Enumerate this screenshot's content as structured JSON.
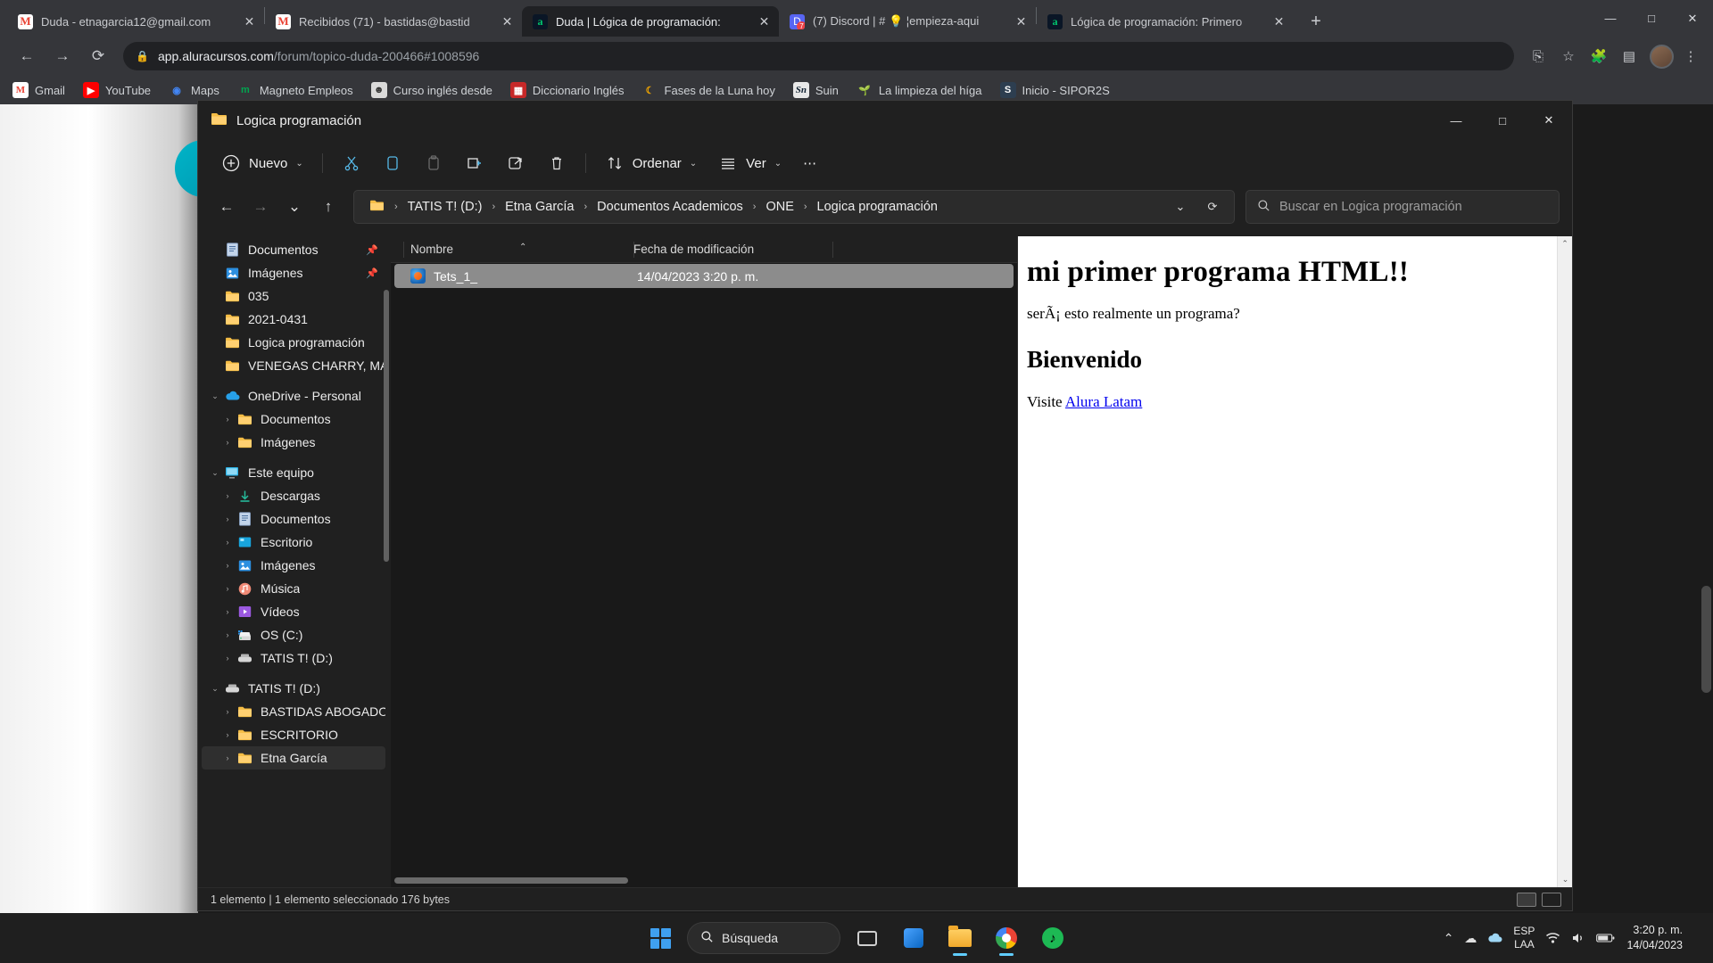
{
  "browser": {
    "tabs": [
      {
        "title": "Duda - etnagarcia12@gmail.com",
        "favicon": "gmail-icon",
        "active": false
      },
      {
        "title": "Recibidos (71) - bastidas@bastid",
        "favicon": "gmail-icon",
        "active": false
      },
      {
        "title": "Duda | Lógica de programación: ",
        "favicon": "alura-icon",
        "active": true
      },
      {
        "title": "(7) Discord | # 💡 ¦empieza-aqui ",
        "favicon": "discord-icon",
        "active": false
      },
      {
        "title": "Lógica de programación: Primero",
        "favicon": "alura-icon",
        "active": false
      }
    ],
    "new_tab_label": "+",
    "window_controls": {
      "minimize": "—",
      "maximize": "□",
      "close": "✕"
    },
    "nav": {
      "back": "←",
      "forward": "→",
      "reload": "⟳"
    },
    "url": {
      "lock": "🔒",
      "host": "app.aluracursos.com",
      "path": "/forum/topico-duda-200466#1008596"
    },
    "omnibox_end": {
      "install": "⎘",
      "bookmark": "☆",
      "extensions": "🧩",
      "sidepanel": "▤",
      "menu": "⋮"
    },
    "bookmarks": [
      {
        "label": "Gmail",
        "icon": "gmail-icon"
      },
      {
        "label": "YouTube",
        "icon": "youtube-icon"
      },
      {
        "label": "Maps",
        "icon": "maps-pin-icon"
      },
      {
        "label": "Magneto Empleos",
        "icon": "magneto-icon"
      },
      {
        "label": "Curso inglés desde",
        "icon": "photo-icon"
      },
      {
        "label": "Diccionario Inglés",
        "icon": "dictionary-icon"
      },
      {
        "label": "Fases de la Luna hoy",
        "icon": "moon-icon"
      },
      {
        "label": "Suin",
        "icon": "suin-icon"
      },
      {
        "label": "La limpieza del híga",
        "icon": "plant-icon"
      },
      {
        "label": "Inicio - SIPOR2S",
        "icon": "sipor-icon"
      }
    ]
  },
  "explorer": {
    "title": "Logica programación",
    "title_icon": "folder-icon",
    "window_controls": {
      "minimize": "—",
      "maximize": "□",
      "close": "✕"
    },
    "toolbar": {
      "new_label": "Nuevo",
      "new_icon": "plus-circle-icon",
      "cut_icon": "scissors-icon",
      "copy_icon": "copy-icon",
      "paste_icon": "paste-icon",
      "rename_icon": "rename-icon",
      "share_icon": "share-icon",
      "delete_icon": "trash-icon",
      "sort_label": "Ordenar",
      "sort_icon": "sort-arrows-icon",
      "view_label": "Ver",
      "view_icon": "list-view-icon",
      "more_label": "⋯",
      "caret": "⌄"
    },
    "address": {
      "back": "←",
      "forward": "→",
      "recent": "⌄",
      "up": "↑",
      "folder_icon": "folder-icon",
      "breadcrumb": [
        "TATIS T! (D:)",
        "Etna García",
        "Documentos Academicos",
        "ONE",
        "Logica programación"
      ],
      "separator": "›",
      "dropdown": "⌄",
      "refresh": "⟳",
      "search_placeholder": "Buscar en Logica programación",
      "search_value": "",
      "search_icon": "search-icon"
    },
    "nav_pane": [
      {
        "label": "Documentos",
        "icon": "documents-icon",
        "chevron": "",
        "pinned": true,
        "indent": 1,
        "selected": false
      },
      {
        "label": "Imágenes",
        "icon": "pictures-icon",
        "chevron": "",
        "pinned": true,
        "indent": 1,
        "selected": false
      },
      {
        "label": "035",
        "icon": "folder-icon",
        "chevron": "",
        "pinned": false,
        "indent": 1,
        "selected": false
      },
      {
        "label": "2021-0431",
        "icon": "folder-icon",
        "chevron": "",
        "pinned": false,
        "indent": 1,
        "selected": false
      },
      {
        "label": "Logica programación",
        "icon": "folder-icon",
        "chevron": "",
        "pinned": false,
        "indent": 1,
        "selected": false
      },
      {
        "label": "VENEGAS CHARRY, MARI",
        "icon": "folder-icon",
        "chevron": "",
        "pinned": false,
        "indent": 1,
        "selected": false
      },
      {
        "label": "OneDrive - Personal",
        "icon": "onedrive-icon",
        "chevron": "⌄",
        "pinned": false,
        "indent": 0,
        "selected": false
      },
      {
        "label": "Documentos",
        "icon": "folder-icon",
        "chevron": "›",
        "pinned": false,
        "indent": 2,
        "selected": false
      },
      {
        "label": "Imágenes",
        "icon": "folder-icon",
        "chevron": "›",
        "pinned": false,
        "indent": 2,
        "selected": false
      },
      {
        "label": "Este equipo",
        "icon": "this-pc-icon",
        "chevron": "⌄",
        "pinned": false,
        "indent": 0,
        "selected": false
      },
      {
        "label": "Descargas",
        "icon": "downloads-icon",
        "chevron": "›",
        "pinned": false,
        "indent": 2,
        "selected": false
      },
      {
        "label": "Documentos",
        "icon": "documents-icon",
        "chevron": "›",
        "pinned": false,
        "indent": 2,
        "selected": false
      },
      {
        "label": "Escritorio",
        "icon": "desktop-icon",
        "chevron": "›",
        "pinned": false,
        "indent": 2,
        "selected": false
      },
      {
        "label": "Imágenes",
        "icon": "pictures-icon",
        "chevron": "›",
        "pinned": false,
        "indent": 2,
        "selected": false
      },
      {
        "label": "Música",
        "icon": "music-icon",
        "chevron": "›",
        "pinned": false,
        "indent": 2,
        "selected": false
      },
      {
        "label": "Vídeos",
        "icon": "videos-icon",
        "chevron": "›",
        "pinned": false,
        "indent": 2,
        "selected": false
      },
      {
        "label": "OS (C:)",
        "icon": "drive-icon",
        "chevron": "›",
        "pinned": false,
        "indent": 2,
        "selected": false
      },
      {
        "label": "TATIS T! (D:)",
        "icon": "usb-drive-icon",
        "chevron": "›",
        "pinned": false,
        "indent": 2,
        "selected": false
      },
      {
        "label": "TATIS T! (D:)",
        "icon": "usb-drive-icon",
        "chevron": "⌄",
        "pinned": false,
        "indent": 0,
        "selected": false
      },
      {
        "label": "BASTIDAS ABOGADOS",
        "icon": "folder-icon",
        "chevron": "›",
        "pinned": false,
        "indent": 2,
        "selected": false
      },
      {
        "label": "ESCRITORIO",
        "icon": "folder-icon",
        "chevron": "›",
        "pinned": false,
        "indent": 2,
        "selected": false
      },
      {
        "label": "Etna García",
        "icon": "folder-icon",
        "chevron": "›",
        "pinned": false,
        "indent": 2,
        "selected": true
      }
    ],
    "file_list": {
      "columns": [
        "Nombre",
        "Fecha de modificación"
      ],
      "sort_caret": "⌃",
      "rows": [
        {
          "name": "Tets_1_",
          "date": "14/04/2023 3:20 p. m.",
          "icon": "html-file-icon",
          "selected": true
        }
      ]
    },
    "preview": {
      "heading": "mi primer programa HTML!!",
      "lead": "serÃ¡ esto realmente un programa?",
      "subheading": "Bienvenido",
      "visit_prefix": "Visite ",
      "link_text": "Alura Latam",
      "scroll_up": "⌃",
      "scroll_down": "⌄"
    },
    "status": {
      "text": "1 elemento  |  1 elemento seleccionado  176 bytes"
    }
  },
  "taskbar": {
    "start_label": "start-icon",
    "search_placeholder": "Búsqueda",
    "search_icon": "search-icon",
    "items": [
      {
        "name": "task-view",
        "icon": "task-view-icon",
        "running": false
      },
      {
        "name": "widgets",
        "icon": "widgets-icon",
        "running": false
      },
      {
        "name": "file-explorer",
        "icon": "file-explorer-icon",
        "running": true
      },
      {
        "name": "chrome",
        "icon": "chrome-icon",
        "running": true
      },
      {
        "name": "spotify",
        "icon": "spotify-icon",
        "running": false
      }
    ],
    "tray": {
      "chevron": "⌃",
      "cloud_icon": "cloud-icon",
      "onedrive_icon": "onedrive-icon",
      "language_line1": "ESP",
      "language_line2": "LAA",
      "wifi_icon": "wifi-icon",
      "volume_icon": "volume-icon",
      "battery_icon": "battery-icon",
      "time": "3:20 p. m.",
      "date": "14/04/2023"
    }
  }
}
